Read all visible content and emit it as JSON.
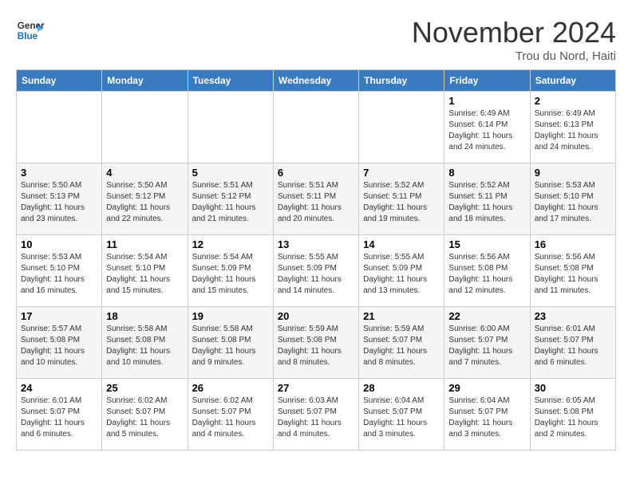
{
  "logo": {
    "line1": "General",
    "line2": "Blue"
  },
  "title": "November 2024",
  "subtitle": "Trou du Nord, Haiti",
  "days_of_week": [
    "Sunday",
    "Monday",
    "Tuesday",
    "Wednesday",
    "Thursday",
    "Friday",
    "Saturday"
  ],
  "weeks": [
    [
      {
        "day": "",
        "info": ""
      },
      {
        "day": "",
        "info": ""
      },
      {
        "day": "",
        "info": ""
      },
      {
        "day": "",
        "info": ""
      },
      {
        "day": "",
        "info": ""
      },
      {
        "day": "1",
        "info": "Sunrise: 6:49 AM\nSunset: 6:14 PM\nDaylight: 11 hours and 24 minutes."
      },
      {
        "day": "2",
        "info": "Sunrise: 6:49 AM\nSunset: 6:13 PM\nDaylight: 11 hours and 24 minutes."
      }
    ],
    [
      {
        "day": "3",
        "info": "Sunrise: 5:50 AM\nSunset: 5:13 PM\nDaylight: 11 hours and 23 minutes."
      },
      {
        "day": "4",
        "info": "Sunrise: 5:50 AM\nSunset: 5:12 PM\nDaylight: 11 hours and 22 minutes."
      },
      {
        "day": "5",
        "info": "Sunrise: 5:51 AM\nSunset: 5:12 PM\nDaylight: 11 hours and 21 minutes."
      },
      {
        "day": "6",
        "info": "Sunrise: 5:51 AM\nSunset: 5:11 PM\nDaylight: 11 hours and 20 minutes."
      },
      {
        "day": "7",
        "info": "Sunrise: 5:52 AM\nSunset: 5:11 PM\nDaylight: 11 hours and 19 minutes."
      },
      {
        "day": "8",
        "info": "Sunrise: 5:52 AM\nSunset: 5:11 PM\nDaylight: 11 hours and 18 minutes."
      },
      {
        "day": "9",
        "info": "Sunrise: 5:53 AM\nSunset: 5:10 PM\nDaylight: 11 hours and 17 minutes."
      }
    ],
    [
      {
        "day": "10",
        "info": "Sunrise: 5:53 AM\nSunset: 5:10 PM\nDaylight: 11 hours and 16 minutes."
      },
      {
        "day": "11",
        "info": "Sunrise: 5:54 AM\nSunset: 5:10 PM\nDaylight: 11 hours and 15 minutes."
      },
      {
        "day": "12",
        "info": "Sunrise: 5:54 AM\nSunset: 5:09 PM\nDaylight: 11 hours and 15 minutes."
      },
      {
        "day": "13",
        "info": "Sunrise: 5:55 AM\nSunset: 5:09 PM\nDaylight: 11 hours and 14 minutes."
      },
      {
        "day": "14",
        "info": "Sunrise: 5:55 AM\nSunset: 5:09 PM\nDaylight: 11 hours and 13 minutes."
      },
      {
        "day": "15",
        "info": "Sunrise: 5:56 AM\nSunset: 5:08 PM\nDaylight: 11 hours and 12 minutes."
      },
      {
        "day": "16",
        "info": "Sunrise: 5:56 AM\nSunset: 5:08 PM\nDaylight: 11 hours and 11 minutes."
      }
    ],
    [
      {
        "day": "17",
        "info": "Sunrise: 5:57 AM\nSunset: 5:08 PM\nDaylight: 11 hours and 10 minutes."
      },
      {
        "day": "18",
        "info": "Sunrise: 5:58 AM\nSunset: 5:08 PM\nDaylight: 11 hours and 10 minutes."
      },
      {
        "day": "19",
        "info": "Sunrise: 5:58 AM\nSunset: 5:08 PM\nDaylight: 11 hours and 9 minutes."
      },
      {
        "day": "20",
        "info": "Sunrise: 5:59 AM\nSunset: 5:08 PM\nDaylight: 11 hours and 8 minutes."
      },
      {
        "day": "21",
        "info": "Sunrise: 5:59 AM\nSunset: 5:07 PM\nDaylight: 11 hours and 8 minutes."
      },
      {
        "day": "22",
        "info": "Sunrise: 6:00 AM\nSunset: 5:07 PM\nDaylight: 11 hours and 7 minutes."
      },
      {
        "day": "23",
        "info": "Sunrise: 6:01 AM\nSunset: 5:07 PM\nDaylight: 11 hours and 6 minutes."
      }
    ],
    [
      {
        "day": "24",
        "info": "Sunrise: 6:01 AM\nSunset: 5:07 PM\nDaylight: 11 hours and 6 minutes."
      },
      {
        "day": "25",
        "info": "Sunrise: 6:02 AM\nSunset: 5:07 PM\nDaylight: 11 hours and 5 minutes."
      },
      {
        "day": "26",
        "info": "Sunrise: 6:02 AM\nSunset: 5:07 PM\nDaylight: 11 hours and 4 minutes."
      },
      {
        "day": "27",
        "info": "Sunrise: 6:03 AM\nSunset: 5:07 PM\nDaylight: 11 hours and 4 minutes."
      },
      {
        "day": "28",
        "info": "Sunrise: 6:04 AM\nSunset: 5:07 PM\nDaylight: 11 hours and 3 minutes."
      },
      {
        "day": "29",
        "info": "Sunrise: 6:04 AM\nSunset: 5:07 PM\nDaylight: 11 hours and 3 minutes."
      },
      {
        "day": "30",
        "info": "Sunrise: 6:05 AM\nSunset: 5:08 PM\nDaylight: 11 hours and 2 minutes."
      }
    ]
  ]
}
